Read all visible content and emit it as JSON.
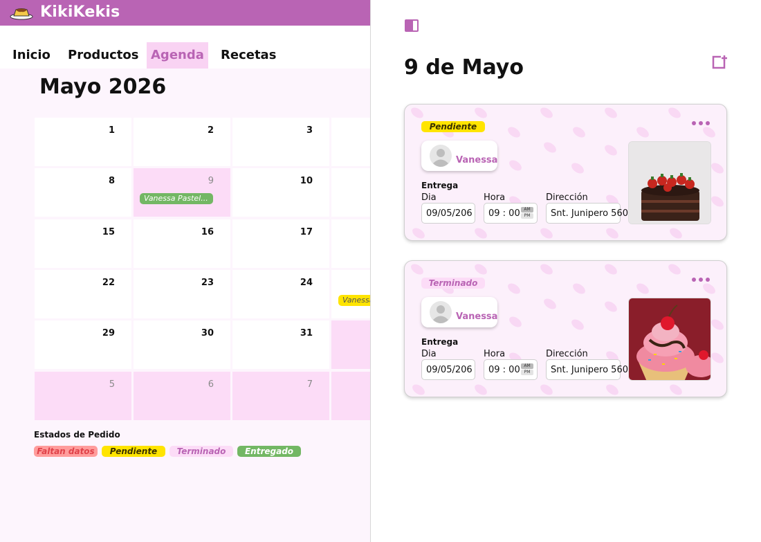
{
  "app": {
    "title": "KikiKekis",
    "logo_icon": "flan-icon"
  },
  "nav": {
    "items": [
      "Inicio",
      "Productos",
      "Agenda",
      "Recetas"
    ],
    "active": "Agenda"
  },
  "calendar": {
    "month_title": "Mayo 2026",
    "visible_days": [
      "1",
      "2",
      "3",
      "8",
      "9",
      "10",
      "15",
      "16",
      "17",
      "22",
      "23",
      "24",
      "29",
      "30",
      "31",
      "5",
      "6",
      "7"
    ],
    "events": {
      "may9_chip": "Vanessa Pastel...",
      "may25_chip": "Vanessa"
    }
  },
  "legend": {
    "title": "Estados de Pedido",
    "items": [
      {
        "label": "Faltan datos",
        "bg": "#ff9c9c",
        "fg": "#e0424a"
      },
      {
        "label": "Pendiente",
        "bg": "#ffe400",
        "fg": "#3b3200"
      },
      {
        "label": "Terminado",
        "bg": "#fcdcf7",
        "fg": "#b964b4"
      },
      {
        "label": "Entregado",
        "bg": "#73b764",
        "fg": "#ffffff"
      }
    ]
  },
  "detail": {
    "day_title": "9 de Mayo",
    "entrega_label": "Entrega",
    "labels": {
      "dia": "Dia",
      "hora": "Hora",
      "direccion": "Dirección"
    },
    "ampm": {
      "am": "AM",
      "pm": "PM"
    },
    "orders": [
      {
        "status": "Pendiente",
        "status_bg": "#ffe400",
        "status_fg": "#3b3200",
        "client": "Vanessa",
        "dia": "09/05/206",
        "hora": "09 : 00",
        "direccion": "Snt. Junipero 560",
        "image": "chocolate-cake-photo"
      },
      {
        "status": "Terminado",
        "status_bg": "#fcdcf7",
        "status_fg": "#b964b4",
        "client": "Vanessa",
        "dia": "09/05/206",
        "hora": "09 : 00",
        "direccion": "Snt. Junipero 560",
        "image": "cupcake-photo"
      }
    ]
  },
  "colors": {
    "brand": "#b964b4",
    "highlight": "#fcdcf7",
    "pane_bg": "#fdf5fd"
  },
  "icons": [
    "flan-icon",
    "sidebar-toggle-icon",
    "add-calendar-icon",
    "more-icon",
    "user-avatar-icon"
  ]
}
